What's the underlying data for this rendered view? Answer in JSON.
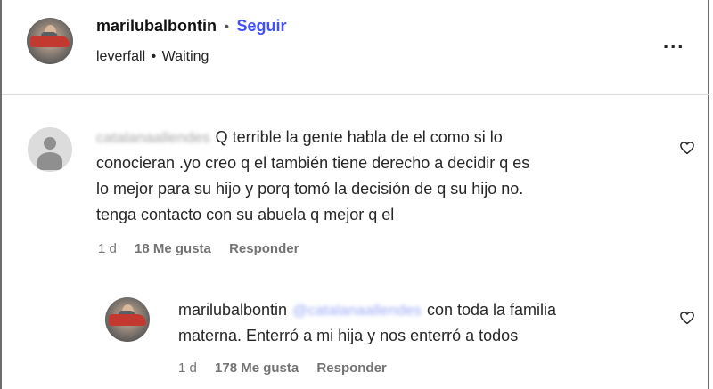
{
  "post_header": {
    "username": "marilubalbontin",
    "separator": "•",
    "follow_label": "Seguir",
    "subline_user": "leverfall",
    "subline_sep": "•",
    "subline_status": "Waiting",
    "more_label": "..."
  },
  "comments": [
    {
      "author": "catalanaallendes",
      "text": "Q terrible la gente habla de el como si lo conocieran .yo creo q el también tiene derecho a decidir q es lo mejor para su hijo y porq tomó la decisión de q su hijo no. tenga contacto con su abuela q mejor q el",
      "line1": "Q terrible la gente habla de el como si lo",
      "line2": "conocieran .yo creo q el también tiene derecho a decidir q es",
      "line3": "lo mejor para su hijo y porq tomó la decisión de q su hijo no.",
      "line4": "tenga contacto con su abuela q mejor q el",
      "time": "1 d",
      "likes": "18 Me gusta",
      "reply_label": "Responder"
    },
    {
      "author": "marilubalbontin",
      "mention": "@catalanaallendes",
      "line1": "con toda la familia",
      "line2": "materna. Enterró a mi hija y nos enterró a todos",
      "time": "1 d",
      "likes": "178 Me gusta",
      "reply_label": "Responder"
    }
  ],
  "icons": {
    "heart": "heart-icon",
    "more": "more-options-icon",
    "avatar_placeholder": "default-avatar-icon"
  },
  "colors": {
    "follow": "#4150f7",
    "meta": "#737373",
    "text": "#262626"
  }
}
